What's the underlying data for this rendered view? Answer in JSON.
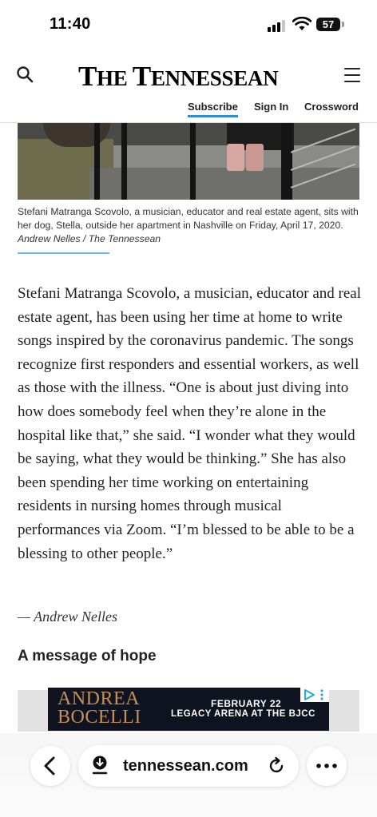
{
  "status_bar": {
    "time": "11:40",
    "battery": "57"
  },
  "header": {
    "logo_prefix_big": "T",
    "logo_prefix_small": "HE ",
    "logo_mid_big": "T",
    "logo_mid_small": "ENNESSEAN",
    "links": {
      "subscribe": "Subscribe",
      "sign_in": "Sign In",
      "crossword": "Crossword"
    }
  },
  "article": {
    "caption_text": "Stefani Matranga Scovolo, a musician, educator and real estate agent, sits with her dog, Stella, outside her apartment in Nashville on Friday, April 17, 2020.",
    "caption_credit": "Andrew Nelles / The Tennessean",
    "body": "Stefani Matranga Scovolo, a musician, educator and real estate agent, has been using her time at home to write songs inspired by the coronavirus pandemic. The songs recognize first responders and essential workers, as well as those with the illness. “One is about just diving into how does somebody feel when they’re alone in the hospital like that,” she said. “I wonder what they would be saying, what they would be thinking.” She has also been spending her time working on entertaining residents in nursing homes through musical performances via Zoom. “I’m blessed to be able to be a blessing to other people.”",
    "byline": "— Andrew Nelles",
    "subhead": "A message of hope"
  },
  "ad": {
    "name_line1": "ANDREA",
    "name_line2": "BOCELLI",
    "date": "FEBRUARY 22",
    "venue": "LEGACY ARENA AT THE BJCC"
  },
  "browser": {
    "url": "tennessean.com"
  },
  "colors": {
    "accent_blue": "#2d8cd6",
    "caption_rule": "#6bb5ea",
    "ad_background": "#0f1320",
    "ad_gold": "#c68f58"
  }
}
